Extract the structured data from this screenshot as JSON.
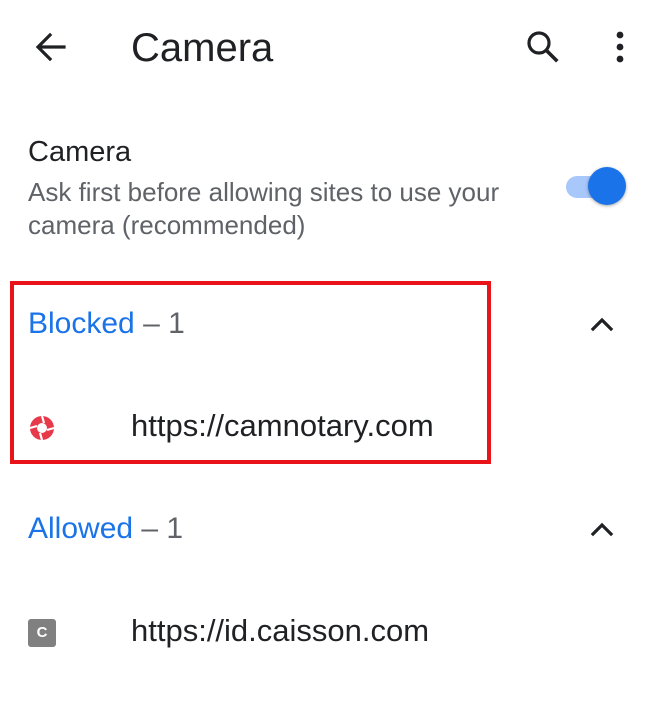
{
  "appbar": {
    "title": "Camera",
    "back_icon": "arrow-back-icon",
    "search_icon": "search-icon",
    "more_icon": "more-vert-icon"
  },
  "setting": {
    "title": "Camera",
    "description": "Ask first before allowing sites to use your camera (recommended)",
    "toggle_on": true
  },
  "groups": [
    {
      "name": "Blocked",
      "count": " – 1",
      "expanded": true,
      "sites": [
        {
          "url": "https://camnotary.com",
          "icon": "site-favicon-icon"
        }
      ]
    },
    {
      "name": "Allowed",
      "count": " – 1",
      "expanded": true,
      "sites": [
        {
          "url": "https://id.caisson.com",
          "icon_letter": "C"
        }
      ]
    }
  ],
  "colors": {
    "accent": "#1a73e8",
    "highlight": "#e8141a"
  }
}
